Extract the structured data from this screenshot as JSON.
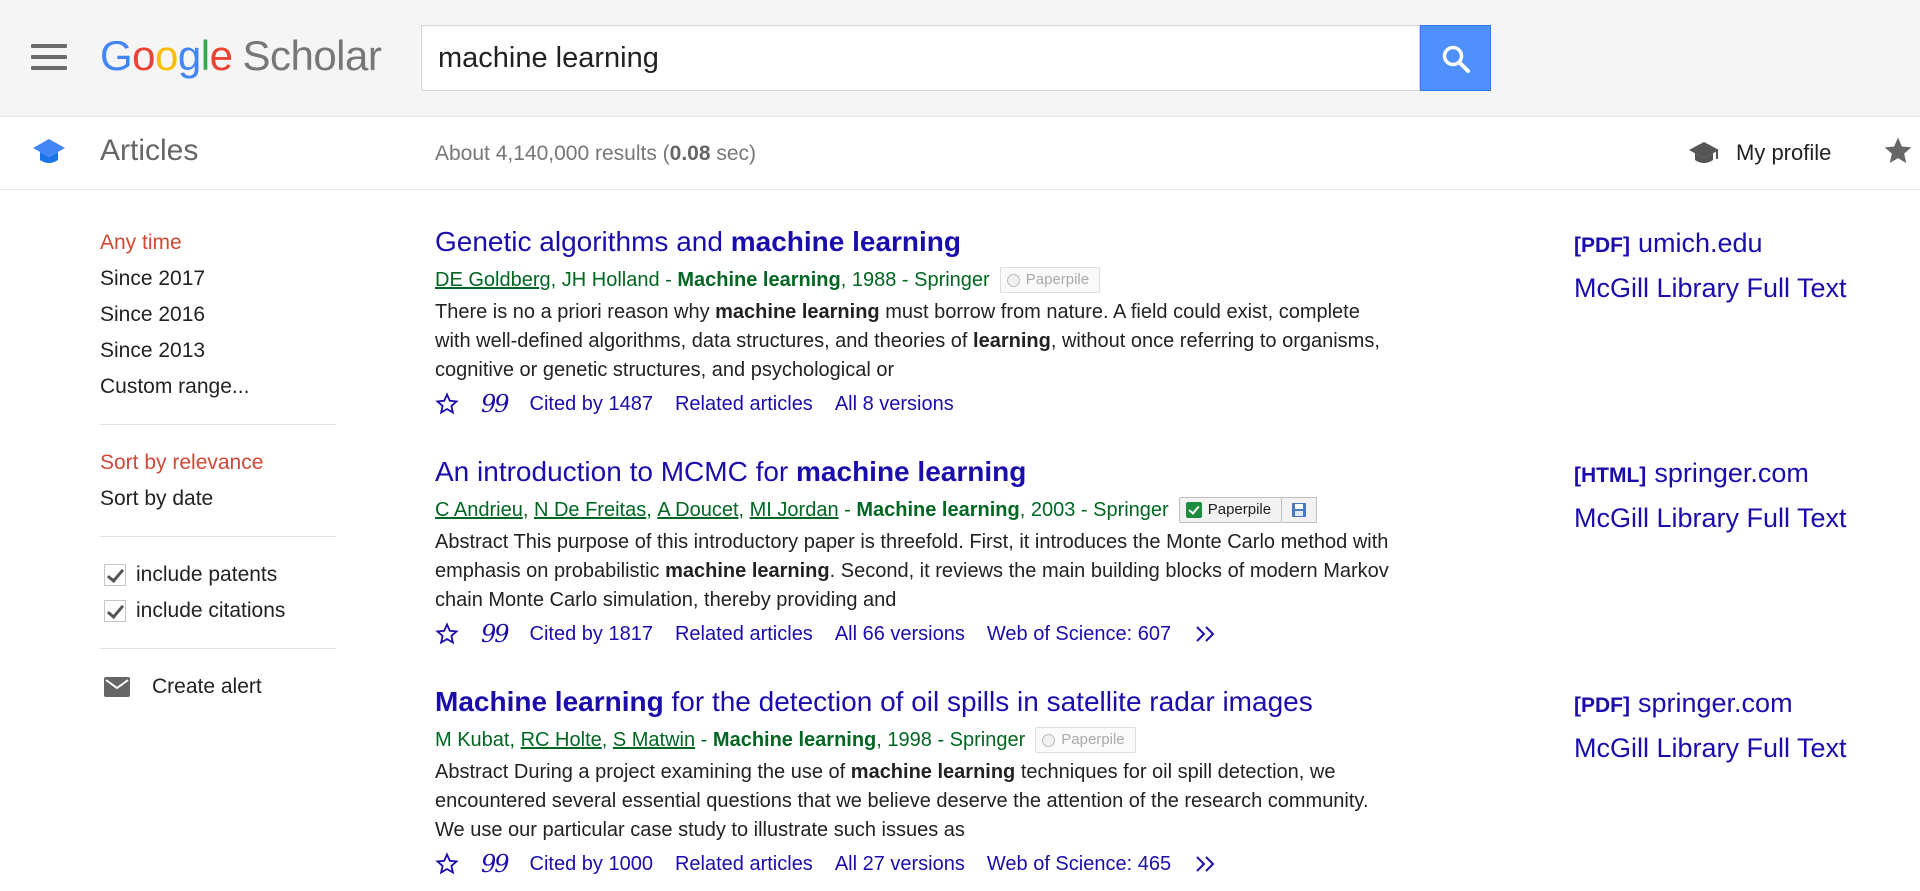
{
  "header": {
    "logo_letters": [
      "G",
      "o",
      "o",
      "g",
      "l",
      "e"
    ],
    "logo_product": "Scholar",
    "search_value": "machine learning",
    "icons": {
      "menu": "hamburger-menu-icon",
      "search": "search-icon"
    }
  },
  "subheader": {
    "section": "Articles",
    "results_prefix": "About 4,140,000 results (",
    "results_time": "0.08",
    "results_suffix": " sec)",
    "profile_label": "My profile",
    "icons": {
      "section": "scholar-cap-icon",
      "profile": "graduation-cap-icon",
      "library": "star-icon"
    }
  },
  "sidebar": {
    "time_filters": [
      "Any time",
      "Since 2017",
      "Since 2016",
      "Since 2013",
      "Custom range..."
    ],
    "sort_options": [
      "Sort by relevance",
      "Sort by date"
    ],
    "checkboxes": [
      "include patents",
      "include citations"
    ],
    "alert_label": "Create alert"
  },
  "colors": {
    "link": "#1a0dab",
    "green": "#006621",
    "active": "#d14836",
    "search_button": "#4d90fe"
  },
  "results": [
    {
      "title_plain": "Genetic algorithms and ",
      "title_bold": "machine learning",
      "authors": [
        "DE Goldberg",
        "JH Holland"
      ],
      "authors_last_plain": "",
      "venue": "Machine learning",
      "year_publisher": ", 1988 - Springer",
      "paperpile": "Paperpile",
      "snippet": [
        {
          "t": "There is no a priori reason why "
        },
        {
          "t": "machine learning",
          "b": true
        },
        {
          "t": " must borrow from nature. A field could exist, complete with well-defined algorithms, data structures, and theories of "
        },
        {
          "t": "learning",
          "b": true
        },
        {
          "t": ", without once referring to organisms, cognitive or genetic structures, and psychological or"
        }
      ],
      "cited_by": "Cited by 1487",
      "related": "Related articles",
      "versions": "All 8 versions",
      "side_format": "[PDF]",
      "side_source": "umich.edu",
      "side_library": "McGill Library Full Text"
    },
    {
      "title_plain": "An introduction to MCMC for ",
      "title_bold": "machine learning",
      "authors": [
        "C Andrieu",
        "N De Freitas",
        "A Doucet",
        "MI Jordan"
      ],
      "venue": "Machine learning",
      "year_publisher": ", 2003 - Springer",
      "paperpile": "Paperpile",
      "snippet": [
        {
          "t": "Abstract This purpose of this introductory paper is threefold. First, it introduces the Monte Carlo method with emphasis on probabilistic "
        },
        {
          "t": "machine learning",
          "b": true
        },
        {
          "t": ". Second, it reviews the main building blocks of modern Markov chain Monte Carlo simulation, thereby providing and"
        }
      ],
      "cited_by": "Cited by 1817",
      "related": "Related articles",
      "versions": "All 66 versions",
      "web_of_science": "Web of Science: 607",
      "side_format": "[HTML]",
      "side_source": "springer.com",
      "side_library": "McGill Library Full Text"
    },
    {
      "title_bold": "Machine learning",
      "title_plain": " for the detection of oil spills in satellite radar images",
      "author_first_plain": "M Kubat",
      "authors": [
        "RC Holte",
        "S Matwin"
      ],
      "venue": "Machine learning",
      "year_publisher": ", 1998 - Springer",
      "paperpile": "Paperpile",
      "snippet": [
        {
          "t": "Abstract During a project examining the use of "
        },
        {
          "t": "machine learning",
          "b": true
        },
        {
          "t": " techniques for oil spill detection, we encountered several essential questions that we believe deserve the attention of the research community. We use our particular case study to illustrate such issues as"
        }
      ],
      "cited_by": "Cited by 1000",
      "related": "Related articles",
      "versions": "All 27 versions",
      "web_of_science": "Web of Science: 465",
      "side_format": "[PDF]",
      "side_source": "springer.com",
      "side_library": "McGill Library Full Text"
    }
  ]
}
